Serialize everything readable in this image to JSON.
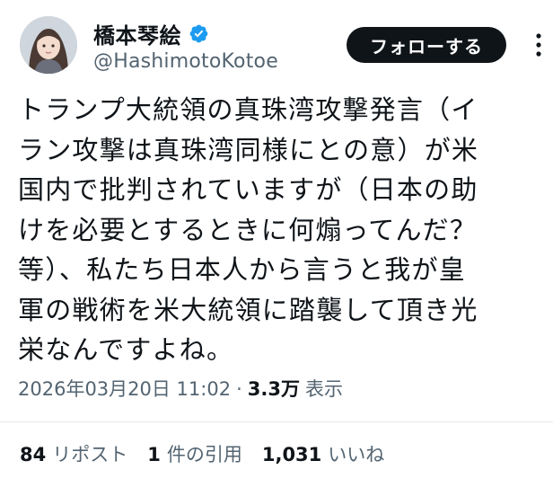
{
  "user": {
    "display_name": "橋本琴絵",
    "handle": "@HashimotoKotoe",
    "verified_color": "#1d9bf0"
  },
  "actions": {
    "follow_label": "フォローする"
  },
  "tweet": {
    "lines": [
      "トランプ大統領の真珠湾攻撃発言（イ",
      "ラン攻撃は真珠湾同様にとの意）が米",
      "国内で批判されていますが（日本の助",
      "けを必要とするときに何煽ってんだ？",
      "等）、私たち日本人から言うと我が皇",
      "軍の戦術を米大統領に踏襲して頂き光",
      "栄なんですよね。"
    ],
    "timestamp": "2026年03月20日 11:02",
    "separator": "·",
    "views_count": "3.3万",
    "views_label": "表示"
  },
  "stats": {
    "reposts_count": "84",
    "reposts_label": "リポスト",
    "quotes_count": "1",
    "quotes_label": "件の引用",
    "likes_count": "1,031",
    "likes_label": "いいね"
  },
  "colors": {
    "text_primary": "#0f1419",
    "text_secondary": "#536471",
    "follow_bg": "#0f1419",
    "follow_text": "#ffffff"
  },
  "icons": {
    "verified": "verified-badge-icon",
    "more": "more-options-icon"
  }
}
